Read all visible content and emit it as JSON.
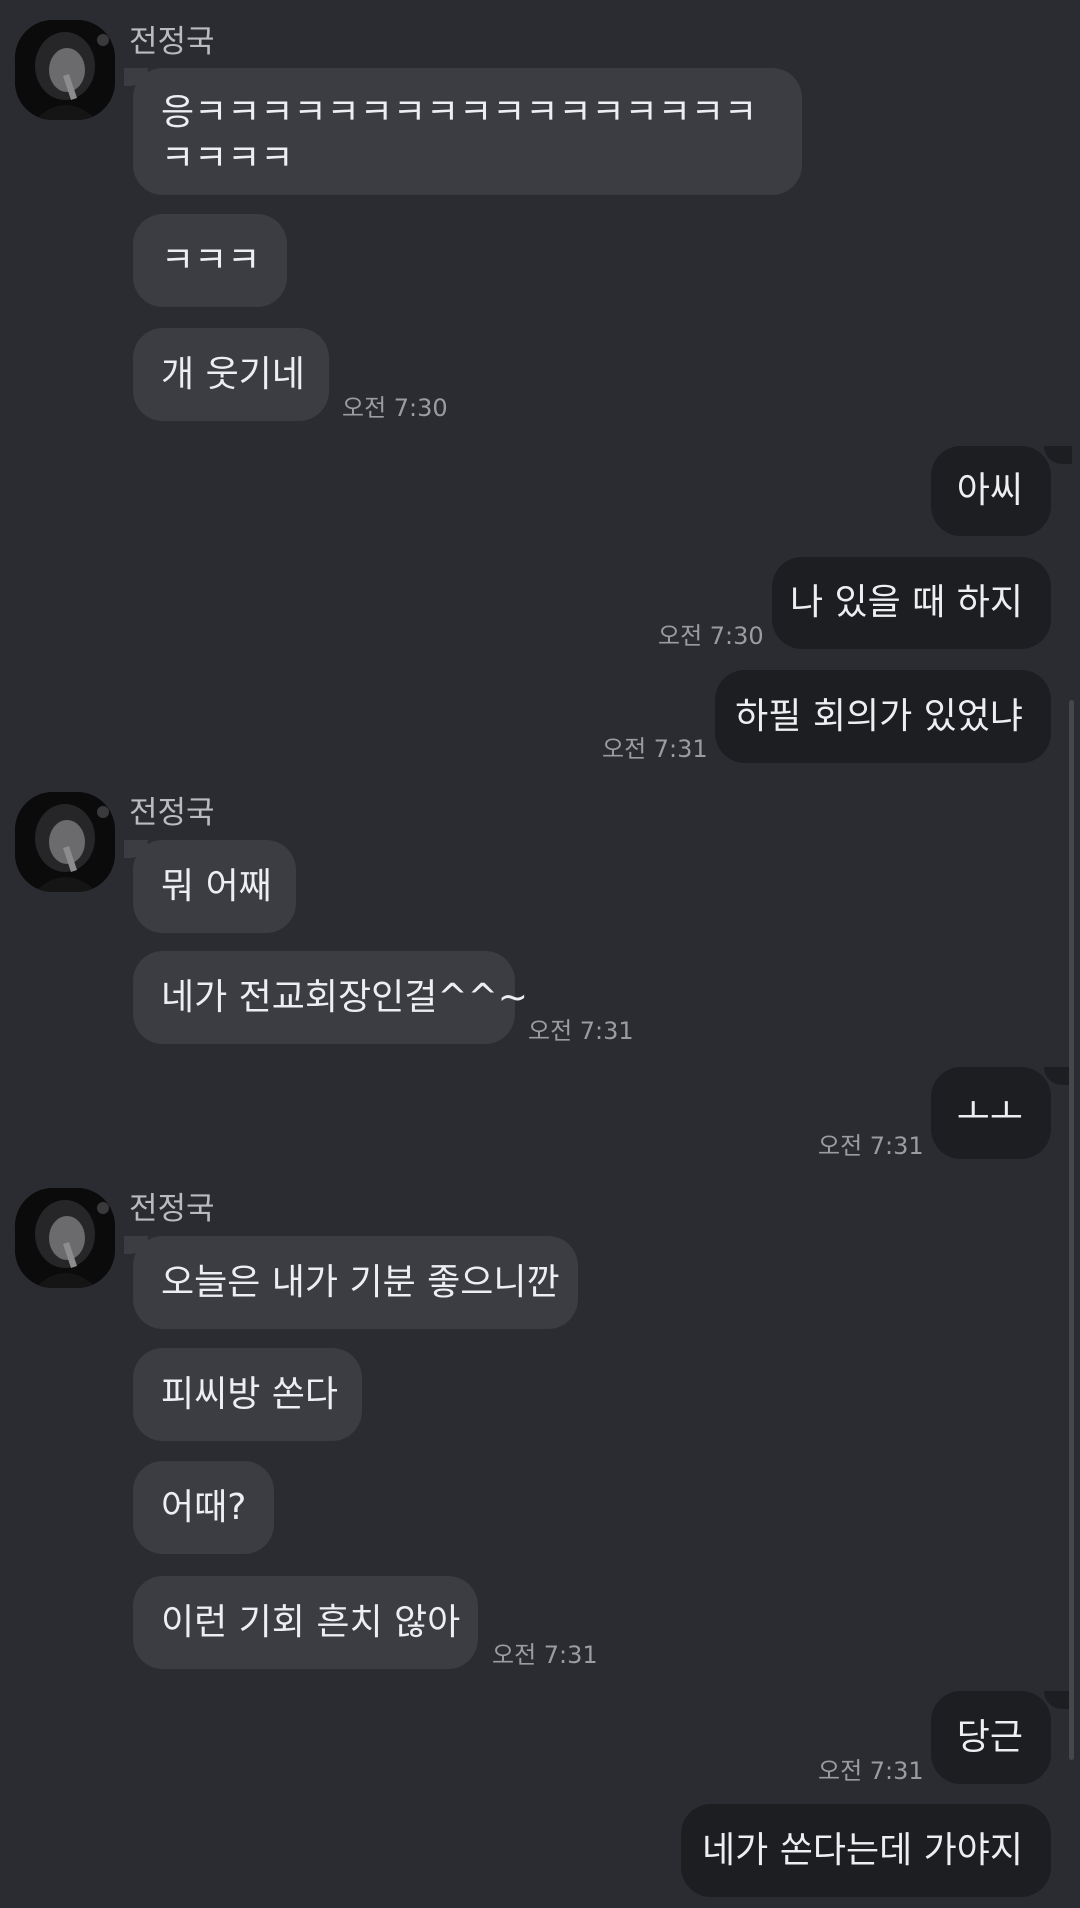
{
  "contact": {
    "name": "전정국"
  },
  "messages": [
    {
      "side": "in",
      "text": "응ㅋㅋㅋㅋㅋㅋㅋㅋㅋㅋㅋㅋㅋㅋㅋㅋㅋㅋㅋㅋㅋ",
      "time": ""
    },
    {
      "side": "in",
      "text": "ㅋㅋㅋ",
      "time": ""
    },
    {
      "side": "in",
      "text": "개 웃기네",
      "time": "오전 7:30"
    },
    {
      "side": "out",
      "text": "아씨",
      "time": ""
    },
    {
      "side": "out",
      "text": "나 있을 때 하지",
      "time": "오전 7:30"
    },
    {
      "side": "out",
      "text": "하필 회의가 있었냐",
      "time": "오전 7:31"
    },
    {
      "side": "in",
      "text": "뭐 어째",
      "time": ""
    },
    {
      "side": "in",
      "text": "네가 전교회장인걸^^~",
      "time": "오전 7:31"
    },
    {
      "side": "out",
      "text": "ㅗㅗ",
      "time": "오전 7:31"
    },
    {
      "side": "in",
      "text": "오늘은 내가 기분 좋으니깐",
      "time": ""
    },
    {
      "side": "in",
      "text": "피씨방 쏜다",
      "time": ""
    },
    {
      "side": "in",
      "text": "어때?",
      "time": ""
    },
    {
      "side": "in",
      "text": "이런 기회 흔치 않아",
      "time": "오전 7:31"
    },
    {
      "side": "out",
      "text": "당근",
      "time": "오전 7:31"
    },
    {
      "side": "out",
      "text": "네가 쏜다는데 가야지",
      "time": ""
    }
  ],
  "colors": {
    "background": "#2a2c31",
    "incoming_bubble": "#3b3d42",
    "outgoing_bubble": "#1d1e21",
    "text": "#eceef1",
    "timestamp": "#9a9ca1"
  }
}
